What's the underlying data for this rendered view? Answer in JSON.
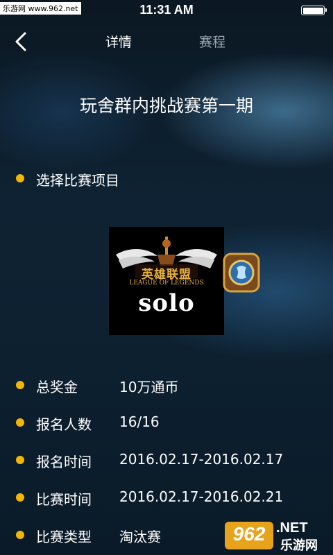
{
  "status_bar": {
    "watermark": "乐游网 www.962.net",
    "time": "11:31 AM",
    "battery_level": 1.0
  },
  "nav": {
    "back_icon": "chevron-left-icon",
    "tabs": [
      {
        "label": "详情",
        "active": true
      },
      {
        "label": "赛程",
        "active": false
      }
    ]
  },
  "page": {
    "title": "玩舍群内挑战赛第一期"
  },
  "section": {
    "select_label": "选择比赛项目"
  },
  "games": {
    "main_tile": {
      "logo_text": "英雄联盟",
      "logo_subtext": "LEAGUE OF LEGENDS",
      "mode": "solo"
    },
    "side_tile": {
      "icon": "hearthstone-icon"
    }
  },
  "details": [
    {
      "label": "总奖金",
      "value": "10万通币"
    },
    {
      "label": "报名人数",
      "value": "16/16"
    },
    {
      "label": "报名时间",
      "value": "2016.02.17-2016.02.17"
    },
    {
      "label": "比赛时间",
      "value": "2016.02.17-2016.02.21"
    },
    {
      "label": "比赛类型",
      "value": "淘汰赛"
    }
  ],
  "watermark_bottom": {
    "number": "962",
    "domain": ".NET",
    "text": "乐游网"
  },
  "colors": {
    "accent": "#f2b705",
    "inactive_tab": "#9aa7b3",
    "text": "#ffffff"
  }
}
